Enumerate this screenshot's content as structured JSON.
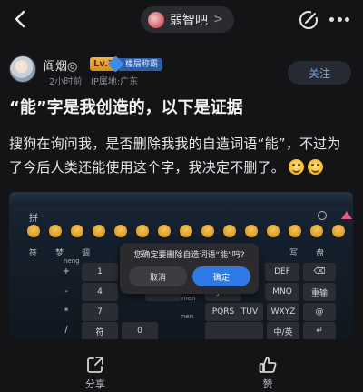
{
  "header": {
    "forum_name": "弱智吧",
    "forum_chevron": ">"
  },
  "author": {
    "name": "阎烟◎",
    "level": "Lv.7",
    "title_badge": "楼层称霸",
    "time": "2小时前",
    "ip_location": "IP属地:广东",
    "follow_label": "关注"
  },
  "post": {
    "title": "“能”字是我创造的，以下是证据",
    "body": "搜狗在询问我，是否删除我我的自造词语“能”，不过为了今后人类还能使用这个字，我决定不删了。"
  },
  "screenshot": {
    "toolbar_text": "拼",
    "candidates": [
      "符",
      "梦",
      "调",
      "手",
      "写",
      "盘"
    ],
    "dialog": {
      "message": "您确定要删除自造词语“能”吗?",
      "cancel_label": "取消",
      "confirm_label": "确定"
    },
    "keys_row1": [
      "1",
      "ABC",
      "DEF"
    ],
    "keys_row2": [
      "4",
      "GHI",
      "JKL",
      "MNO",
      "重输"
    ],
    "keys_row3": [
      "7",
      "PQRS",
      "TUV",
      "WXYZ"
    ],
    "keys_row4": [
      "符",
      "0",
      "中/英"
    ],
    "side_symbols": [
      "+",
      "-",
      "*",
      "/"
    ],
    "candidate_hint": "neng",
    "hint2": "men",
    "hint3": "nen"
  },
  "actions": {
    "share_label": "分享",
    "like_label": "赞"
  }
}
